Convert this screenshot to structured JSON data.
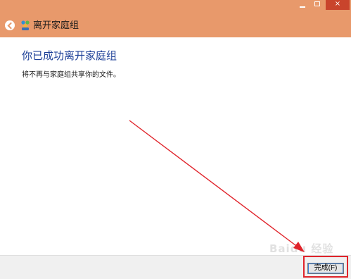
{
  "window": {
    "title": "离开家庭组",
    "controls": {
      "minimize": "minimize-icon",
      "maximize": "maximize-icon",
      "close": "×"
    }
  },
  "content": {
    "heading": "你已成功离开家庭组",
    "message": "将不再与家庭组共享你的文件。"
  },
  "footer": {
    "finish_button": "完成(F)"
  },
  "watermark": "Baidu 经验",
  "colors": {
    "titlebar": "#e8996b",
    "close": "#c9442c",
    "heading": "#1c3f97",
    "annotation": "#e0242b"
  }
}
